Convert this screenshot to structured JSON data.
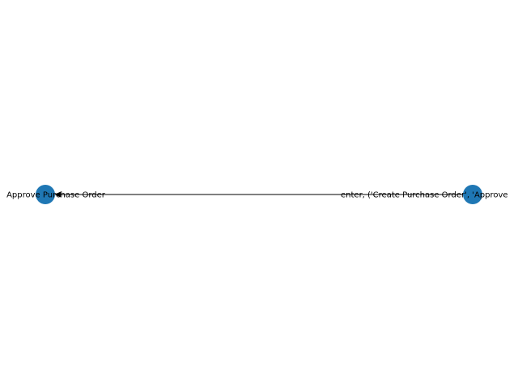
{
  "graph": {
    "nodes": [
      {
        "id": "approve",
        "label": "Approve Purchase Order"
      },
      {
        "id": "enter",
        "label": "enter, ('Create Purchase Order', 'Approve"
      }
    ],
    "edges": [
      {
        "from": "enter",
        "to": "approve"
      }
    ]
  },
  "colors": {
    "node_fill": "#1f77b4",
    "edge_stroke": "#000000",
    "label_text": "#000000",
    "background": "#ffffff"
  }
}
